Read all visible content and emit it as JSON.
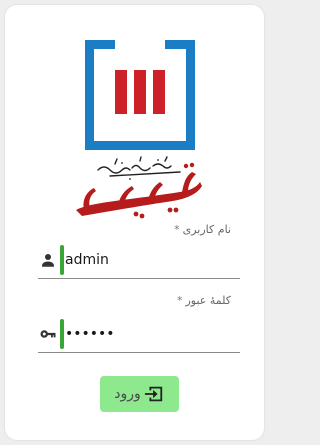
{
  "form": {
    "username_label": "نام کاربری",
    "username_required_mark": "*",
    "username_value": "admin",
    "password_label": "کلمهٔ عبور",
    "password_required_mark": "*",
    "password_value": "••••••",
    "login_label": "ورود"
  },
  "brand": {
    "logo_name": "tadbir-logo",
    "wordmark_text": "تدبیر",
    "tagline_text": "سیستم جامع مالی و اداری",
    "colors": {
      "frame_blue": "#1b7dc4",
      "bar_red": "#cc2129",
      "wordmark_red": "#b71c1c"
    }
  },
  "icons": {
    "user": "person-icon",
    "key": "key-icon",
    "login": "login-enter-icon"
  },
  "colors": {
    "accent_green": "#3aa537",
    "button_bg": "#8ee88e"
  }
}
